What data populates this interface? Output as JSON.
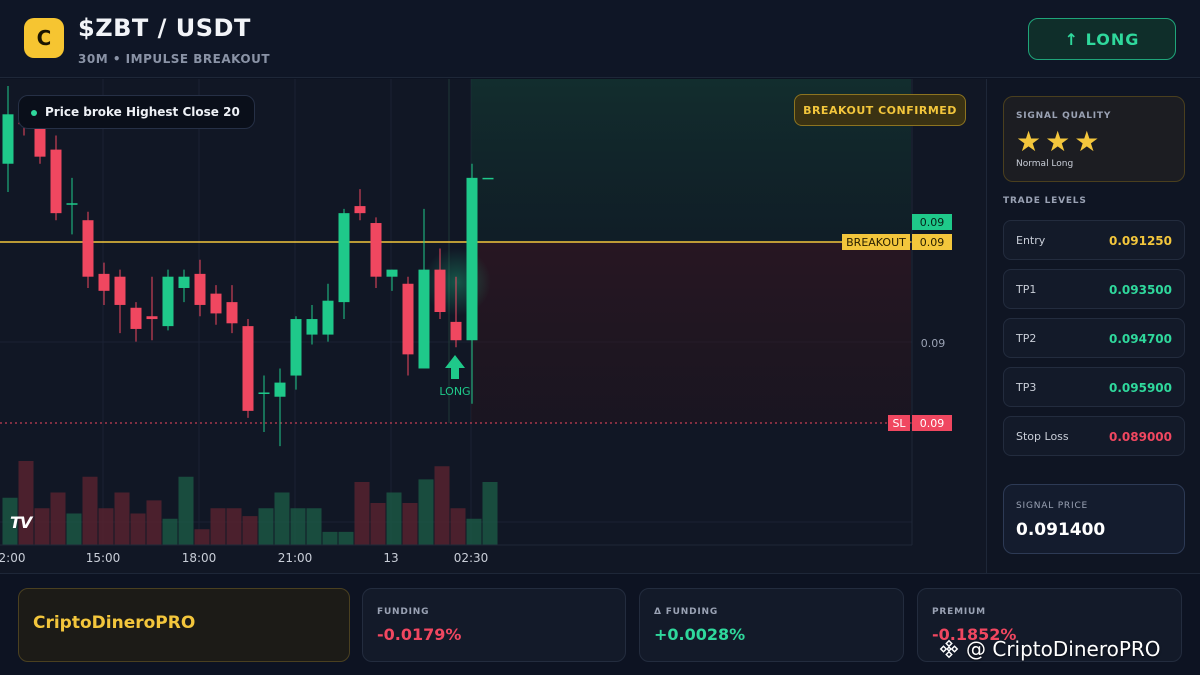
{
  "header": {
    "logo_letter": "C",
    "title": "$ZBT / USDT",
    "subtitle": "30M • IMPULSE BREAKOUT",
    "action_label": "↑ LONG"
  },
  "chart": {
    "info_pill": "Price broke Highest Close 20",
    "confirm_badge": "BREAKOUT CONFIRMED",
    "breakout_label": "BREAKOUT",
    "breakout_value": "0.09",
    "top_value": "0.09",
    "mid_axis_value": "0.09",
    "sl_label": "SL",
    "sl_value": "0.09",
    "signal_marker_label": "LONG",
    "time_labels": [
      "2:00",
      "15:00",
      "18:00",
      "21:00",
      "13",
      "02:30"
    ],
    "watermark_logo": "TV",
    "colors": {
      "up": "#1fc98a",
      "down": "#f04760",
      "breakout": "#f3c63c",
      "sl": "#f04760"
    }
  },
  "chart_data": {
    "type": "candlestick",
    "title": "$ZBT / USDT",
    "candles": [
      {
        "o": 0.0912,
        "h": 0.09175,
        "l": 0.091,
        "c": 0.09155
      },
      {
        "o": 0.09158,
        "h": 0.09168,
        "l": 0.0914,
        "c": 0.09148
      },
      {
        "o": 0.09145,
        "h": 0.0915,
        "l": 0.0912,
        "c": 0.09125
      },
      {
        "o": 0.0913,
        "h": 0.0914,
        "l": 0.0908,
        "c": 0.09085
      },
      {
        "o": 0.09092,
        "h": 0.0911,
        "l": 0.0907,
        "c": 0.09092
      },
      {
        "o": 0.0908,
        "h": 0.09086,
        "l": 0.09032,
        "c": 0.0904
      },
      {
        "o": 0.09042,
        "h": 0.0905,
        "l": 0.0902,
        "c": 0.0903
      },
      {
        "o": 0.0904,
        "h": 0.09045,
        "l": 0.09,
        "c": 0.0902
      },
      {
        "o": 0.09018,
        "h": 0.09022,
        "l": 0.08994,
        "c": 0.09003
      },
      {
        "o": 0.09012,
        "h": 0.0904,
        "l": 0.08995,
        "c": 0.0901
      },
      {
        "o": 0.09005,
        "h": 0.09045,
        "l": 0.09002,
        "c": 0.0904
      },
      {
        "o": 0.09032,
        "h": 0.09045,
        "l": 0.09022,
        "c": 0.0904
      },
      {
        "o": 0.09042,
        "h": 0.09052,
        "l": 0.09012,
        "c": 0.0902
      },
      {
        "o": 0.09028,
        "h": 0.09034,
        "l": 0.09006,
        "c": 0.09014
      },
      {
        "o": 0.09022,
        "h": 0.09034,
        "l": 0.09,
        "c": 0.09007
      },
      {
        "o": 0.09005,
        "h": 0.0901,
        "l": 0.0894,
        "c": 0.08945
      },
      {
        "o": 0.08958,
        "h": 0.0897,
        "l": 0.0893,
        "c": 0.08958
      },
      {
        "o": 0.08955,
        "h": 0.08975,
        "l": 0.0892,
        "c": 0.08965
      },
      {
        "o": 0.0897,
        "h": 0.09012,
        "l": 0.0896,
        "c": 0.0901
      },
      {
        "o": 0.08999,
        "h": 0.0902,
        "l": 0.08992,
        "c": 0.0901
      },
      {
        "o": 0.08999,
        "h": 0.09035,
        "l": 0.08994,
        "c": 0.09023
      },
      {
        "o": 0.09022,
        "h": 0.09088,
        "l": 0.0901,
        "c": 0.09085
      },
      {
        "o": 0.0909,
        "h": 0.09102,
        "l": 0.0908,
        "c": 0.09085
      },
      {
        "o": 0.09078,
        "h": 0.09082,
        "l": 0.09032,
        "c": 0.0904
      },
      {
        "o": 0.0904,
        "h": 0.09045,
        "l": 0.0903,
        "c": 0.09045
      },
      {
        "o": 0.09035,
        "h": 0.0904,
        "l": 0.0897,
        "c": 0.08985
      },
      {
        "o": 0.08975,
        "h": 0.09088,
        "l": 0.08975,
        "c": 0.09045
      },
      {
        "o": 0.09045,
        "h": 0.0906,
        "l": 0.0901,
        "c": 0.09015
      },
      {
        "o": 0.09008,
        "h": 0.0904,
        "l": 0.0899,
        "c": 0.08995
      },
      {
        "o": 0.08995,
        "h": 0.0912,
        "l": 0.0895,
        "c": 0.0911
      },
      {
        "o": 0.0911,
        "h": 0.0911,
        "l": 0.0911,
        "c": 0.0911
      }
    ],
    "volume": [
      18,
      32,
      14,
      20,
      12,
      26,
      14,
      20,
      12,
      17,
      10,
      26,
      6,
      14,
      14,
      11,
      14,
      20,
      14,
      14,
      5,
      5,
      24,
      16,
      20,
      16,
      25,
      30,
      14,
      10,
      24
    ],
    "breakout_level": 0.09095,
    "stop_loss_level": 0.089,
    "signal": "LONG",
    "x_ticks": [
      "2:00",
      "15:00",
      "18:00",
      "21:00",
      "13",
      "02:30"
    ],
    "y_range": [
      0.0885,
      0.0918
    ]
  },
  "side": {
    "quality_label": "SIGNAL QUALITY",
    "stars": "★★★",
    "quality_sub": "Normal Long",
    "levels_title": "TRADE LEVELS",
    "levels": [
      {
        "name": "Entry",
        "value": "0.091250",
        "color": "#f3c63c"
      },
      {
        "name": "TP1",
        "value": "0.093500",
        "color": "#2fd89c"
      },
      {
        "name": "TP2",
        "value": "0.094700",
        "color": "#2fd89c"
      },
      {
        "name": "TP3",
        "value": "0.095900",
        "color": "#2fd89c"
      },
      {
        "name": "Stop Loss",
        "value": "0.089000",
        "color": "#f04760"
      }
    ],
    "signal_price_label": "SIGNAL PRICE",
    "signal_price": "0.091400"
  },
  "bottom": {
    "brand": "CriptoDineroPRO",
    "metrics": [
      {
        "label": "FUNDING",
        "value": "-0.0179%",
        "color": "#f04760"
      },
      {
        "label": "Δ FUNDING",
        "value": "+0.0028%",
        "color": "#2fd89c"
      },
      {
        "label": "PREMIUM",
        "value": "-0.1852%",
        "color": "#f04760"
      }
    ],
    "watermark": "@ CriptoDineroPRO"
  }
}
